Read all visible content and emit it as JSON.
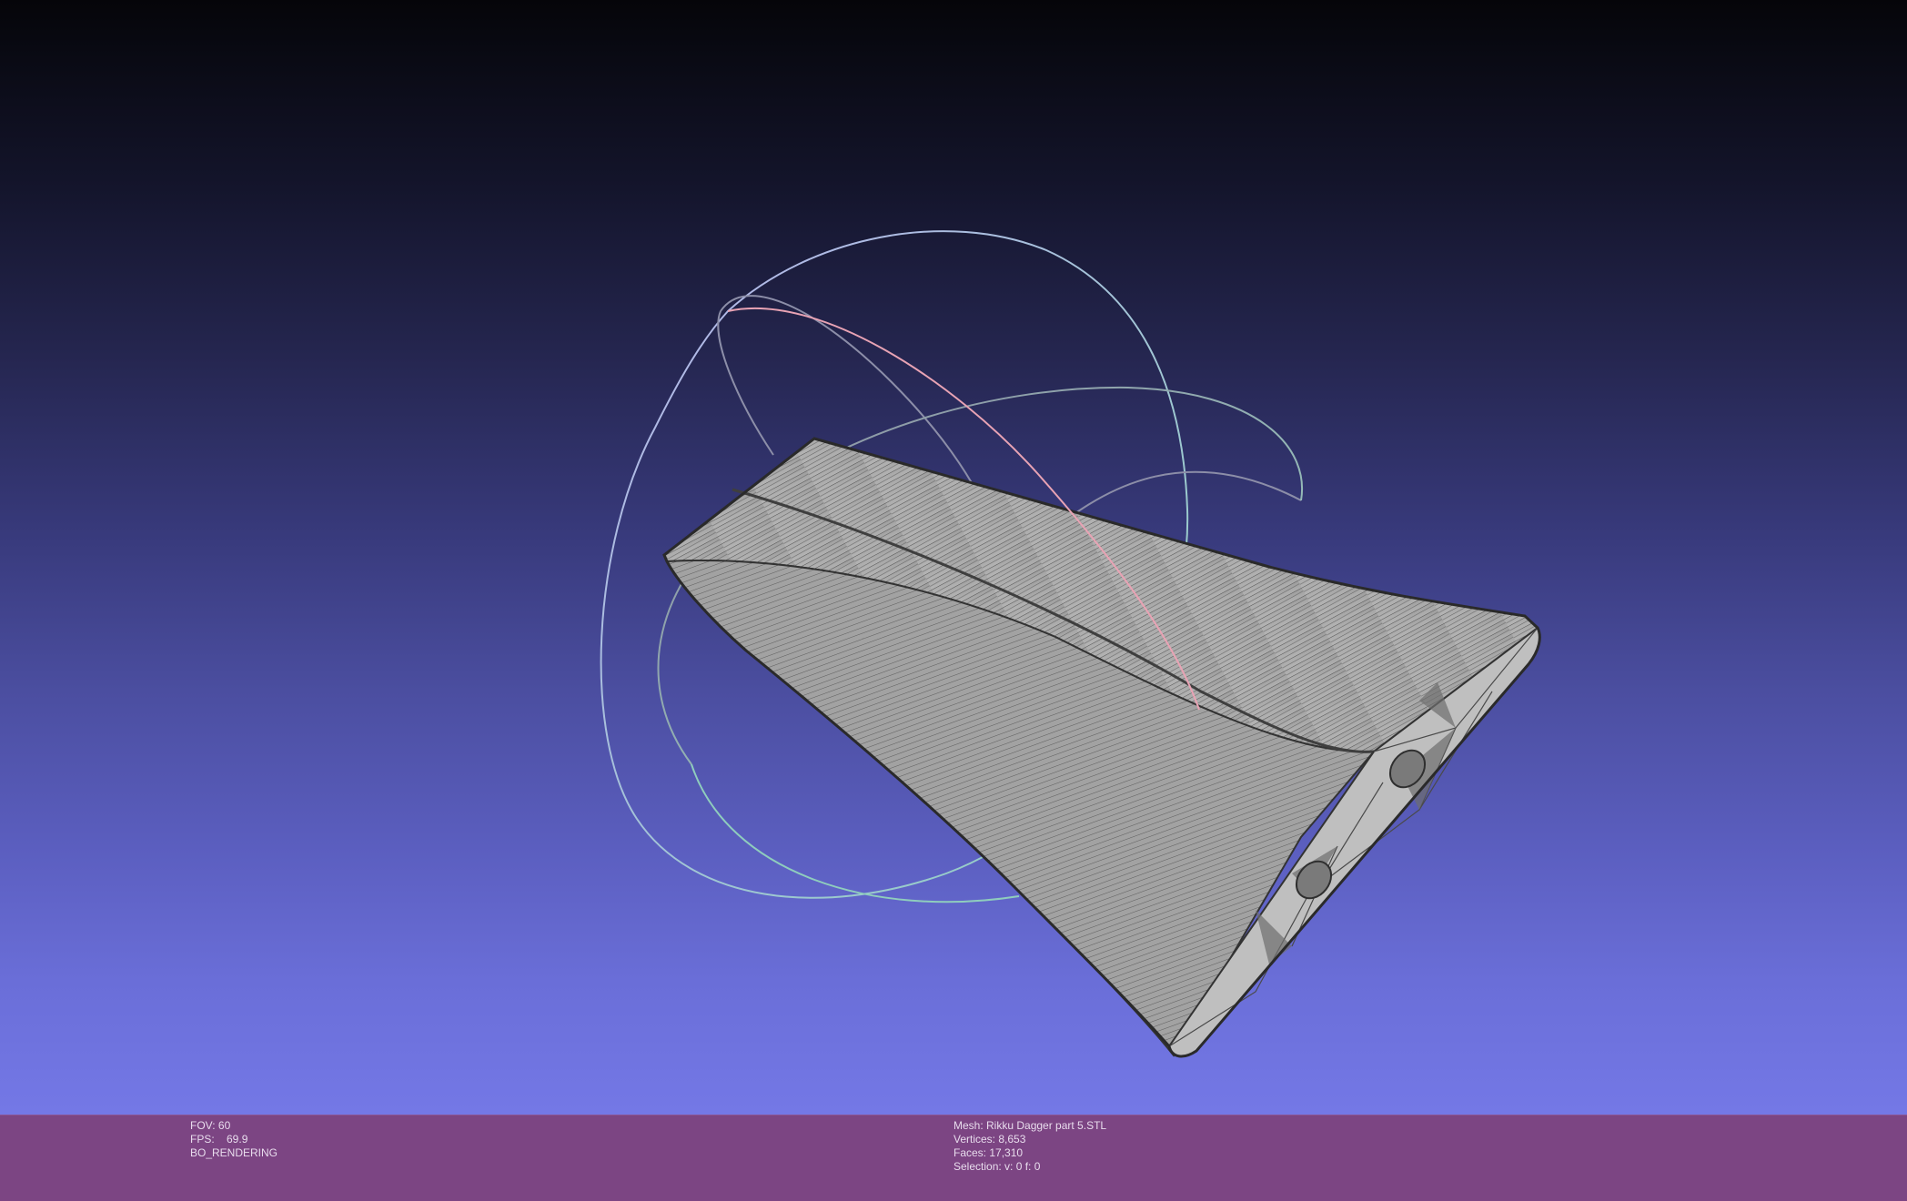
{
  "render_info": {
    "fov": "FOV: 60",
    "fps": "FPS:    69.9",
    "mode": "BO_RENDERING"
  },
  "mesh_info": {
    "mesh": "Mesh: Rikku Dagger part 5.STL",
    "vertices": "Vertices: 8,653",
    "faces": "Faces: 17,310",
    "selection": "Selection: v: 0 f: 0"
  },
  "colors": {
    "status_bar": "#7c4583",
    "mesh_fill": "#a9a9a9",
    "mesh_edge": "#3a3a3a",
    "trackball_x": "#e59aac",
    "trackball_y": "#9ad6c2",
    "trackball_z": "#b1aee6"
  },
  "icons": [
    "trackball-gizmo"
  ]
}
